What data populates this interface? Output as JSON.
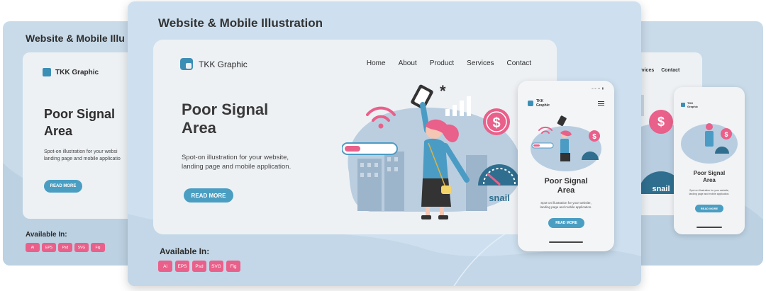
{
  "showcase": {
    "title": "Website & Mobile Illustration",
    "title_left_partial": "Website & Mobile Illu",
    "available_label": "Available In:",
    "formats": [
      "Ai",
      "EPS",
      "Psd",
      "SVG",
      "Fig"
    ]
  },
  "website": {
    "brand": "TKK Graphic",
    "nav": [
      "Home",
      "About",
      "Product",
      "Services",
      "Contact"
    ],
    "nav_right_partial": [
      "rvices",
      "Contact"
    ],
    "hero_title_line1": "Poor Signal",
    "hero_title_line2": "Area",
    "hero_subtitle_line1": "Spot-on illustration for your website,",
    "hero_subtitle_line2": "landing page and mobile application.",
    "left_subtitle_line1": "Spot-on illustration for your websi",
    "left_subtitle_line2": "landing page and mobile applicatio",
    "cta": "READ MORE"
  },
  "mobile": {
    "brand_line1": "TKK",
    "brand_line2": "Graphic",
    "status": "•••  ▾ ▮",
    "hero_title_line1": "Poor Signal",
    "hero_title_line2": "Area",
    "subtitle_line1": "Spot-on illustration for your website,",
    "subtitle_line2": "landing page and mobile application.",
    "cta": "READ MORE"
  },
  "illustration": {
    "snail_label": "snail",
    "star_glyph": "*",
    "currency_glyph": "$"
  },
  "colors": {
    "accent_blue": "#4a9ec2",
    "brand_blue": "#3b8fb5",
    "badge_pink": "#e9608a",
    "bg_panel": "#cee0ef",
    "hair_pink": "#e9608a",
    "jacket_blue": "#4b9cc4"
  },
  "icons": {
    "logo": "tkk-logo-icon",
    "menu": "hamburger-icon",
    "wifi": "wifi-icon",
    "signal": "signal-bars-icon",
    "dollar": "dollar-coin-icon",
    "speedometer": "speedometer-icon",
    "phone": "smartphone-icon"
  }
}
